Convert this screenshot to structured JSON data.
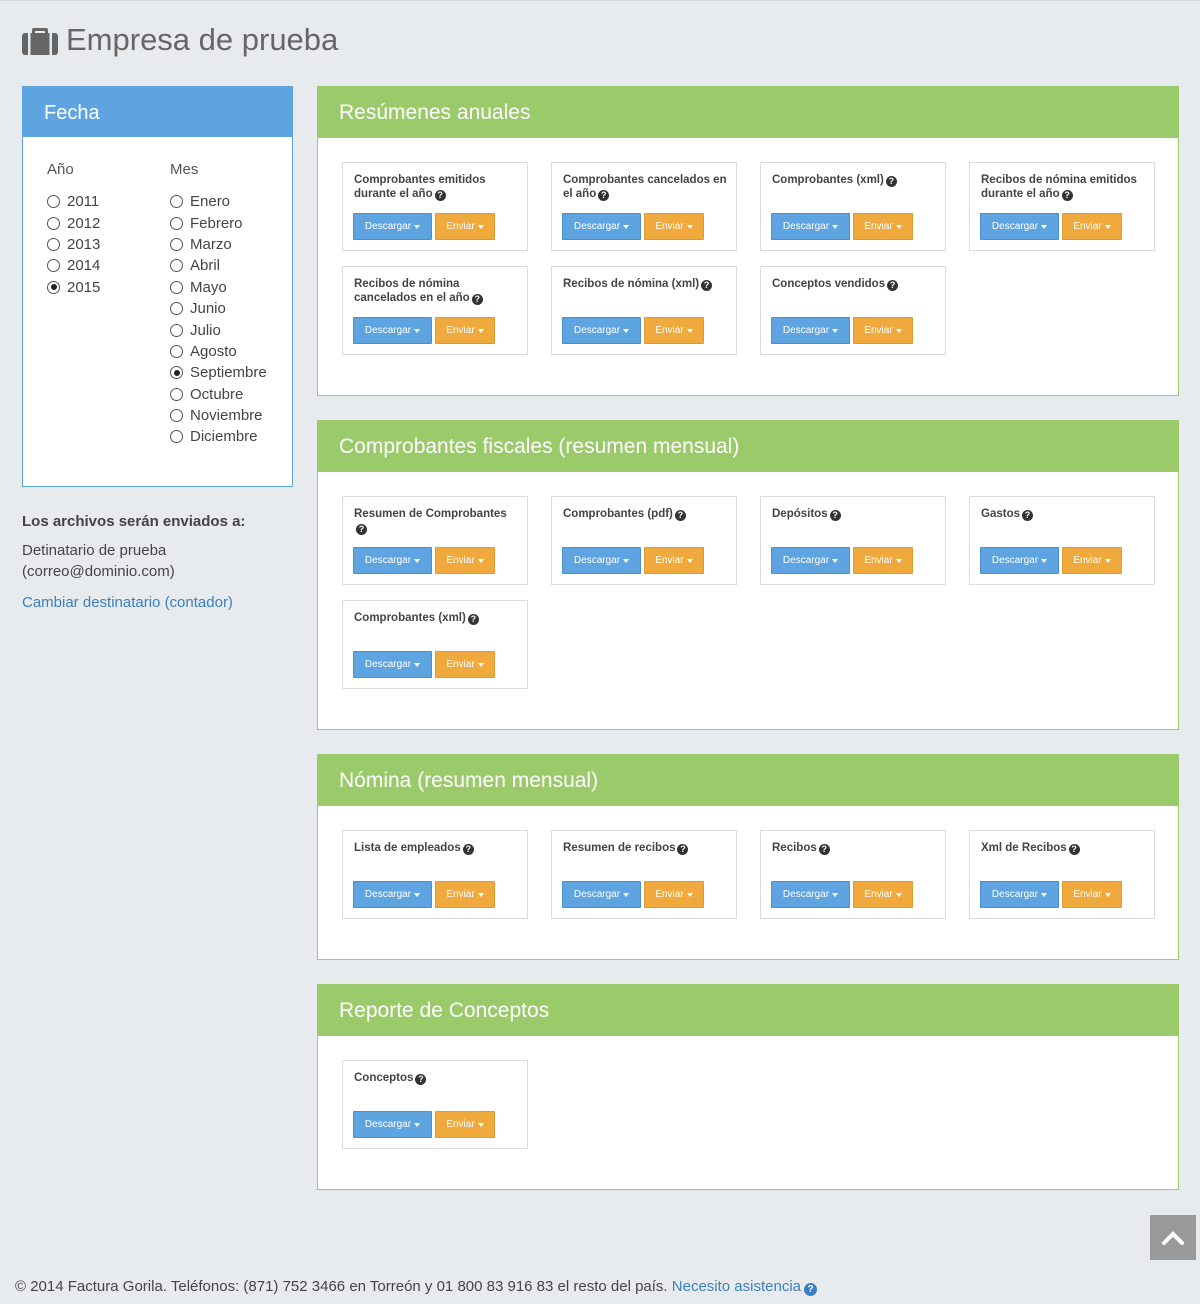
{
  "header": {
    "title": "Empresa de prueba",
    "icon": "briefcase-icon"
  },
  "fecha": {
    "title": "Fecha",
    "year_label": "Año",
    "month_label": "Mes",
    "years": [
      "2011",
      "2012",
      "2013",
      "2014",
      "2015"
    ],
    "selected_year": "2015",
    "months": [
      "Enero",
      "Febrero",
      "Marzo",
      "Abril",
      "Mayo",
      "Junio",
      "Julio",
      "Agosto",
      "Septiembre",
      "Octubre",
      "Noviembre",
      "Diciembre"
    ],
    "selected_month": "Septiembre"
  },
  "recipient": {
    "title": "Los archivos serán enviados a:",
    "name": "Detinatario de prueba",
    "email": "(correo@dominio.com)",
    "change_link": "Cambiar destinatario (contador)"
  },
  "buttons": {
    "download": "Descargar",
    "send": "Enviar"
  },
  "sections": [
    {
      "title": "Resúmenes anuales",
      "cards": [
        "Comprobantes emitidos durante el año",
        "Comprobantes cancelados en el año",
        "Comprobantes (xml)",
        "Recibos de nómina emitidos durante el año",
        "Recibos de nómina cancelados en el año",
        "Recibos de nómina (xml)",
        "Conceptos vendidos"
      ]
    },
    {
      "title": "Comprobantes fiscales (resumen mensual)",
      "cards": [
        "Resumen de Comprobantes",
        "Comprobantes (pdf)",
        "Depósitos",
        "Gastos",
        "Comprobantes (xml)"
      ]
    },
    {
      "title": "Nómina (resumen mensual)",
      "cards": [
        "Lista de empleados",
        "Resumen de recibos",
        "Recibos",
        "Xml de Recibos"
      ]
    },
    {
      "title": "Reporte de Conceptos",
      "cards": [
        "Conceptos"
      ]
    }
  ],
  "footer": {
    "text": "© 2014 Factura Gorila. Teléfonos: (871) 752 3466 en Torreón y 01 800 83 916 83 el resto del país.",
    "help_link": "Necesito asistencia"
  },
  "colors": {
    "blue": "#5ea4e0",
    "green": "#9bca6b",
    "orange": "#efa93d",
    "background": "#e8ebee"
  }
}
